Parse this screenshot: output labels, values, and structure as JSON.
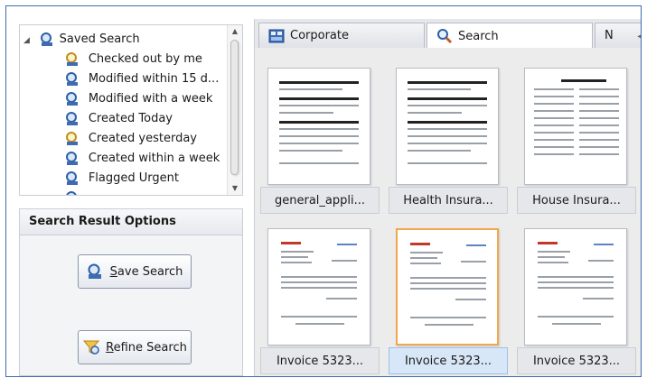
{
  "tree": {
    "root_label": "Saved Search",
    "items": [
      {
        "label": "Checked out by me",
        "icon": "locked-search-icon"
      },
      {
        "label": "Modified within 15 d...",
        "icon": "search-icon"
      },
      {
        "label": "Modified with a week",
        "icon": "search-icon"
      },
      {
        "label": "Created Today",
        "icon": "search-icon"
      },
      {
        "label": "Created yesterday",
        "icon": "locked-search-icon"
      },
      {
        "label": "Created within a week",
        "icon": "search-icon"
      },
      {
        "label": "Flagged Urgent",
        "icon": "search-icon"
      }
    ]
  },
  "options": {
    "header": "Search Result Options",
    "save_first": "S",
    "save_rest": "ave Search",
    "refine_first": "R",
    "refine_rest": "efine Search"
  },
  "tabs": {
    "corporate": "Corporate",
    "search": "Search",
    "next": "N"
  },
  "documents": [
    {
      "label": "general_appli...",
      "selected": false
    },
    {
      "label": "Health Insura...",
      "selected": false
    },
    {
      "label": "House Insura...",
      "selected": false
    },
    {
      "label": "Invoice 5323...",
      "selected": false
    },
    {
      "label": "Invoice 5323...",
      "selected": true
    },
    {
      "label": "Invoice 5323...",
      "selected": false
    }
  ],
  "colors": {
    "frame_border": "#3f6bb3",
    "selection_orange": "#f2a64e",
    "selection_blue": "#d8e7f7"
  }
}
